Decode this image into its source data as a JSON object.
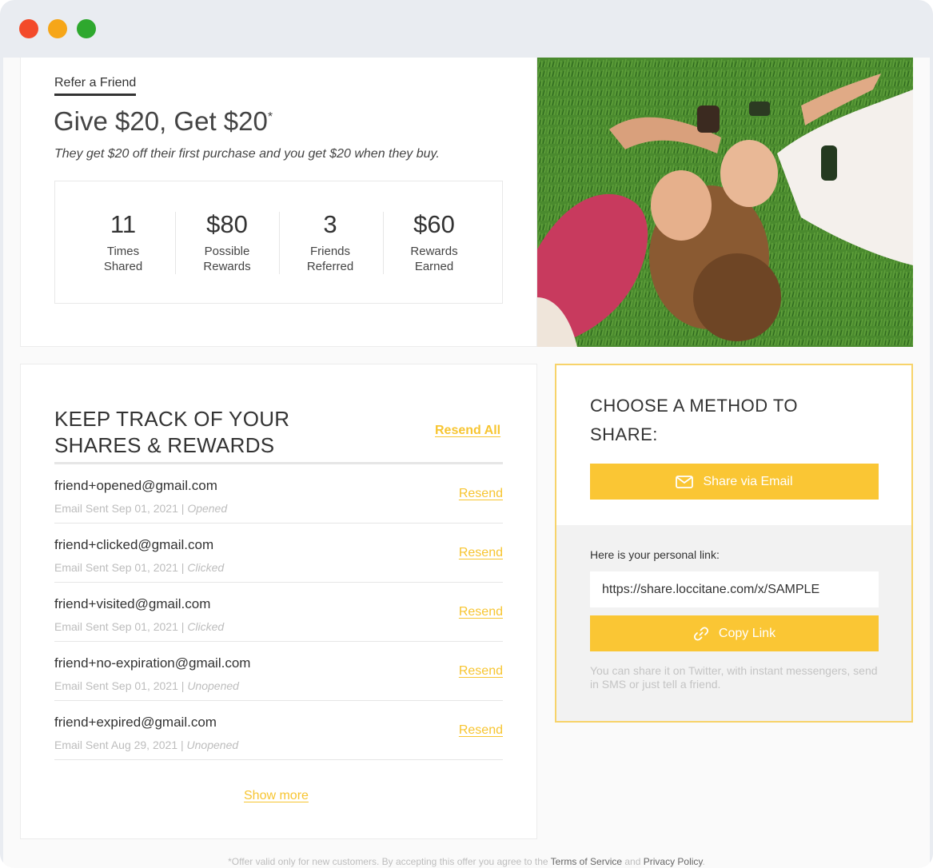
{
  "hero": {
    "tab_label": "Refer a Friend",
    "title": "Give $20, Get $20",
    "title_mark": "*",
    "subtitle": "They get $20 off their first purchase and you get $20 when they buy.",
    "stats": [
      {
        "value": "11",
        "label_line1": "Times",
        "label_line2": "Shared"
      },
      {
        "value": "$80",
        "label_line1": "Possible",
        "label_line2": "Rewards"
      },
      {
        "value": "3",
        "label_line1": "Friends",
        "label_line2": "Referred"
      },
      {
        "value": "$60",
        "label_line1": "Rewards",
        "label_line2": "Earned"
      }
    ]
  },
  "track": {
    "title_line1": "KEEP TRACK OF YOUR",
    "title_line2": "SHARES & REWARDS",
    "resend_all_label": "Resend All",
    "resend_label": "Resend",
    "rows": [
      {
        "email": "friend+opened@gmail.com",
        "sent": "Email Sent Sep 01, 2021 | ",
        "status": "Opened"
      },
      {
        "email": "friend+clicked@gmail.com",
        "sent": "Email Sent Sep 01, 2021 | ",
        "status": "Clicked"
      },
      {
        "email": "friend+visited@gmail.com",
        "sent": "Email Sent Sep 01, 2021 | ",
        "status": "Clicked"
      },
      {
        "email": "friend+no-expiration@gmail.com",
        "sent": "Email Sent Sep 01, 2021 | ",
        "status": "Unopened"
      },
      {
        "email": "friend+expired@gmail.com",
        "sent": "Email Sent Aug 29, 2021 | ",
        "status": "Unopened"
      }
    ],
    "show_more_label": "Show more"
  },
  "share": {
    "title": "CHOOSE A METHOD TO SHARE:",
    "email_button_label": "Share via Email",
    "link_label": "Here is your personal link:",
    "link_value": "https://share.loccitane.com/x/SAMPLE",
    "copy_button_label": "Copy Link",
    "note": "You can share it on Twitter, with instant messengers, send in SMS or just tell a friend."
  },
  "footer": {
    "text_before": "*Offer valid only for new customers. By accepting this offer you agree to the ",
    "terms_label": "Terms of Service",
    "text_and": " and ",
    "privacy_label": "Privacy Policy",
    "text_end": "."
  },
  "colors": {
    "accent": "#fac634",
    "link": "#f7c531",
    "window_chrome": "#e9ecf1",
    "close": "#f34a2a",
    "minimize": "#f6a618",
    "maximize": "#2ea82e"
  },
  "icons": [
    "envelope-icon",
    "link-icon"
  ]
}
